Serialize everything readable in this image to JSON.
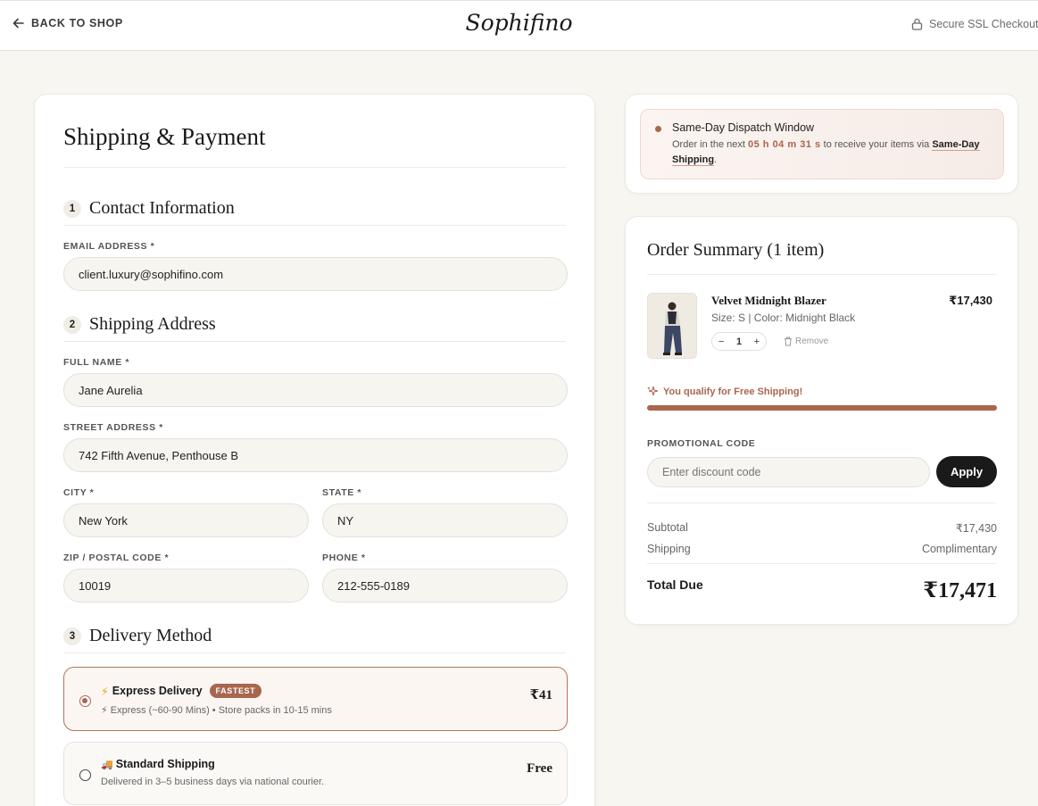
{
  "header": {
    "back_label": "BACK TO SHOP",
    "brand": "Sophifino",
    "secure_label": "Secure SSL Checkout"
  },
  "form": {
    "title": "Shipping & Payment",
    "contact": {
      "number": "1",
      "title": "Contact Information",
      "email_label": "EMAIL ADDRESS *",
      "email_value": "client.luxury@sophifino.com"
    },
    "shipping": {
      "number": "2",
      "title": "Shipping Address",
      "full_name_label": "FULL NAME *",
      "full_name_value": "Jane Aurelia",
      "street_label": "STREET ADDRESS *",
      "street_value": "742 Fifth Avenue, Penthouse B",
      "city_label": "CITY *",
      "city_value": "New York",
      "state_label": "STATE *",
      "state_value": "NY",
      "zip_label": "ZIP / POSTAL CODE *",
      "zip_value": "10019",
      "phone_label": "PHONE *",
      "phone_value": "212-555-0189"
    },
    "delivery": {
      "number": "3",
      "title": "Delivery Method",
      "options": [
        {
          "icon": "⚡",
          "title": "Express Delivery",
          "badge": "FASTEST",
          "desc": "⚡ Express (~60-90 Mins) • Store packs in 10-15 mins",
          "price": "₹41",
          "selected": true
        },
        {
          "icon": "🚚",
          "title": "Standard Shipping",
          "desc": "Delivered in 3–5 business days via national courier.",
          "price": "Free",
          "selected": false
        }
      ]
    }
  },
  "dispatch": {
    "title": "Same-Day Dispatch Window",
    "text_before": "Order in the next",
    "timer": "05 h 04 m 31 s",
    "text_middle": "to receive your items via",
    "link": "Same-Day Shipping",
    "text_after": "."
  },
  "summary": {
    "title": "Order Summary (1 item)",
    "item": {
      "name": "Velvet Midnight Blazer",
      "variant": "Size: S | Color: Midnight Black",
      "price": "₹17,430",
      "qty": "1",
      "minus": "−",
      "plus": "+",
      "remove": "Remove"
    },
    "free_shipping": "You qualify for Free Shipping!",
    "free_shipping_progress": 1.0,
    "promo_label": "PROMOTIONAL CODE",
    "promo_placeholder": "Enter discount code",
    "apply_label": "Apply",
    "subtotal_label": "Subtotal",
    "subtotal_value": "₹17,430",
    "shipping_label": "Shipping",
    "shipping_value": "Complimentary",
    "total_label": "Total Due",
    "total_value": "₹17,471"
  },
  "colors": {
    "accent": "#a8664d",
    "background": "#f8f6f1",
    "dark_button": "#1a1a1a"
  }
}
